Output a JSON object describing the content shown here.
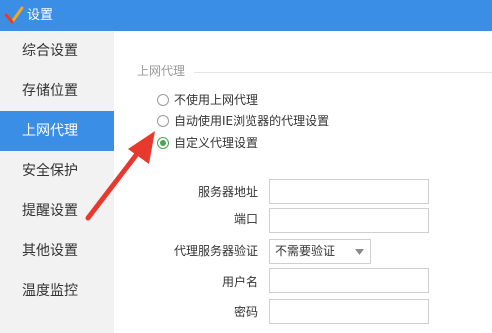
{
  "window": {
    "title": "设置",
    "logo_icon": "check-logo-icon",
    "accent_color": "#3a8ee6"
  },
  "sidebar": {
    "items": [
      {
        "label": "综合设置",
        "active": false
      },
      {
        "label": "存储位置",
        "active": false
      },
      {
        "label": "上网代理",
        "active": true
      },
      {
        "label": "安全保护",
        "active": false
      },
      {
        "label": "提醒设置",
        "active": false
      },
      {
        "label": "其他设置",
        "active": false
      },
      {
        "label": "温度监控",
        "active": false
      }
    ]
  },
  "proxy": {
    "section_title": "上网代理",
    "options": [
      {
        "label": "不使用上网代理",
        "checked": false
      },
      {
        "label": "自动使用IE浏览器的代理设置",
        "checked": false
      },
      {
        "label": "自定义代理设置",
        "checked": true
      }
    ],
    "fields": {
      "server_label": "服务器地址",
      "server_value": "",
      "port_label": "端口",
      "port_value": "",
      "auth_label": "代理服务器验证",
      "auth_selected": "不需要验证",
      "username_label": "用户名",
      "username_value": "",
      "password_label": "密码",
      "password_value": ""
    }
  },
  "annotation": {
    "icon": "red-pointer-arrow-icon",
    "color": "#e8392f"
  }
}
